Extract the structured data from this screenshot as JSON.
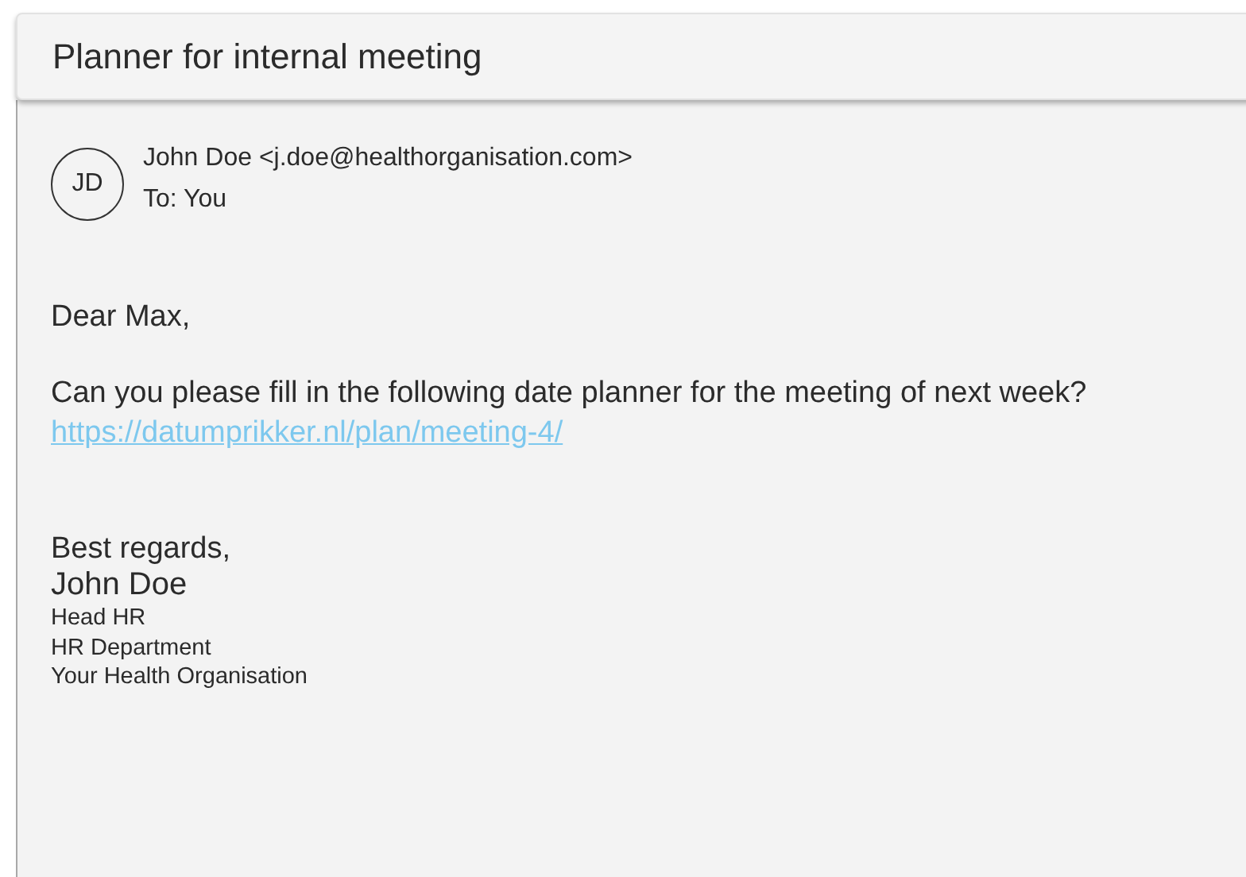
{
  "subject": "Planner for internal meeting",
  "sender": {
    "initials": "JD",
    "from": "John Doe <j.doe@healthorganisation.com>",
    "to": "To: You"
  },
  "body": {
    "greeting": "Dear Max,",
    "text": "Can you please fill in the following date planner for the meeting of next week?",
    "link": "https://datumprikker.nl/plan/meeting-4/"
  },
  "signature": {
    "closing": "Best regards,",
    "name": "John Doe",
    "lines": [
      "Head HR",
      "HR Department",
      "Your Health Organisation"
    ]
  }
}
